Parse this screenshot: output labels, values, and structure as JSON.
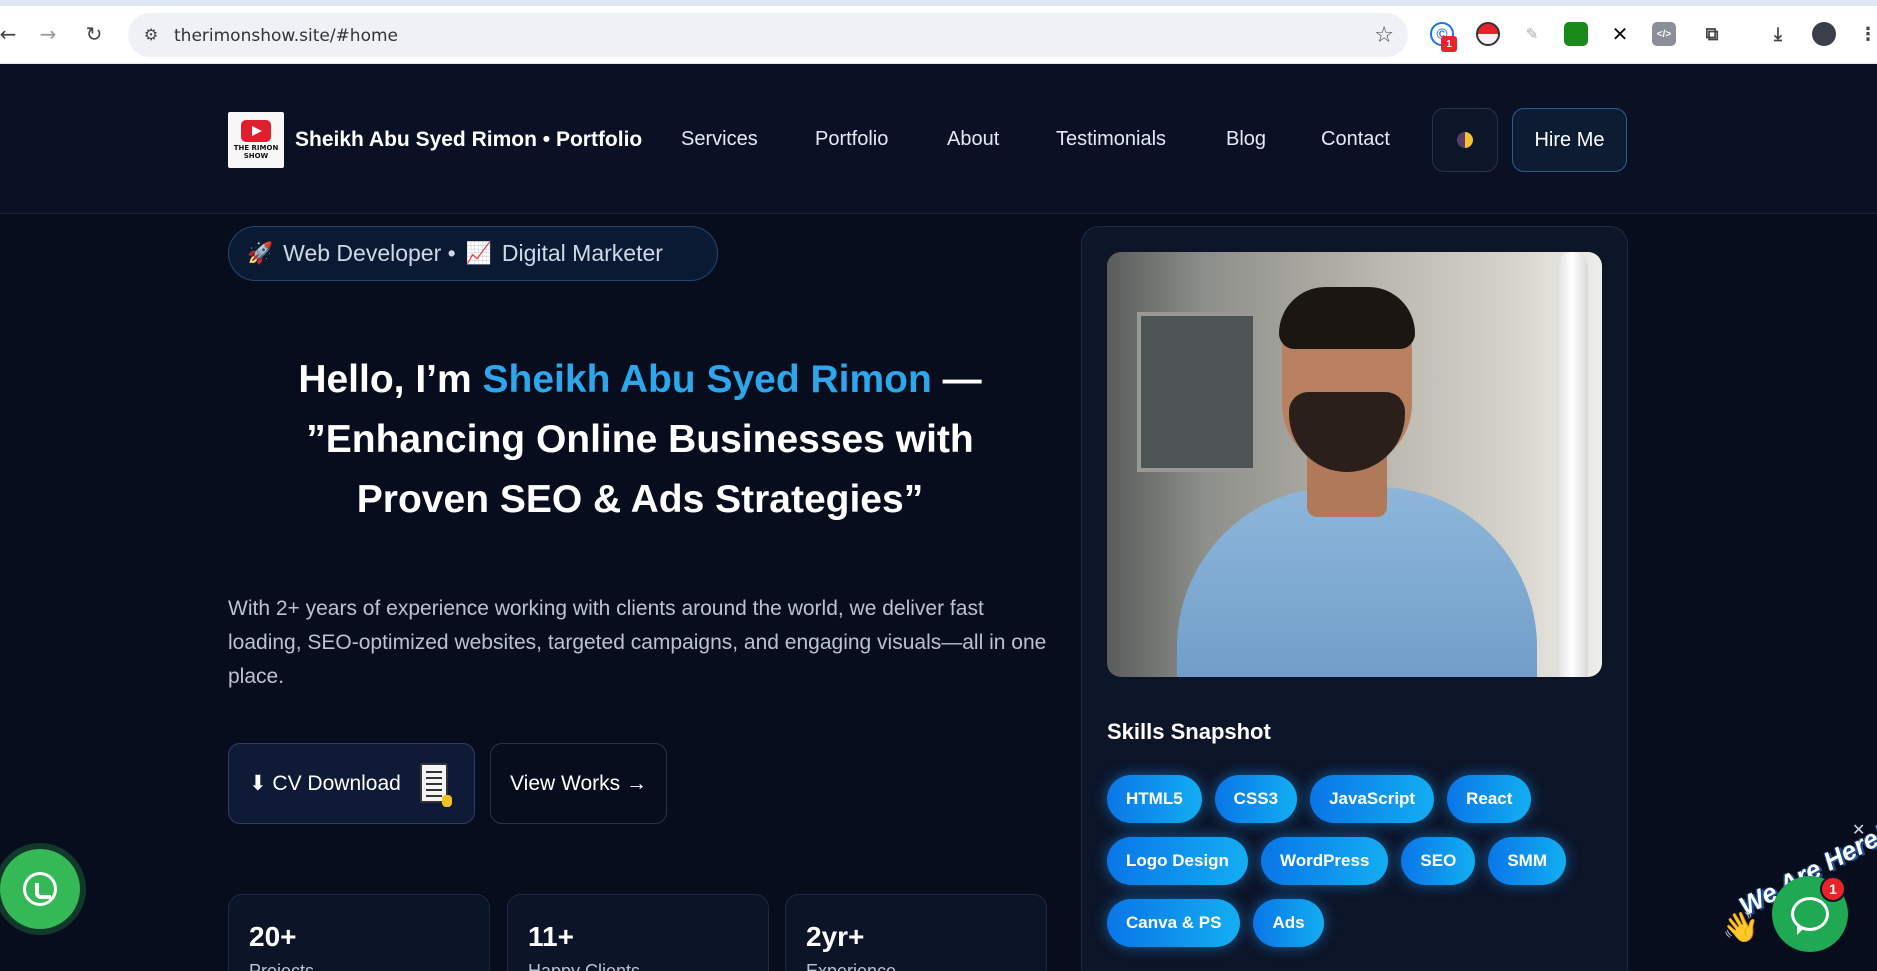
{
  "browser": {
    "url": "therimonshow.site/#home",
    "back_icon": "arrow-left-icon",
    "forward_icon": "arrow-right-icon",
    "reload_icon": "reload-icon",
    "extension_badge": "1"
  },
  "header": {
    "logo_text": "THE RIMON SHOW",
    "brand": "Sheikh Abu Syed Rimon • Portfolio",
    "nav": [
      "Services",
      "Portfolio",
      "About",
      "Testimonials",
      "Blog",
      "Contact"
    ],
    "hire_label": "Hire Me"
  },
  "hero": {
    "role_emoji_1": "🚀",
    "role_text_1": "Web Developer •",
    "role_emoji_2": "📈",
    "role_text_2": "Digital Marketer",
    "title_prefix": "Hello, I’m ",
    "title_name": "Sheikh Abu Syed Rimon",
    "title_suffix": " — ”Enhancing Online Businesses with Proven SEO & Ads Strategies”",
    "description": "With 2+ years of experience working with clients around the world, we deliver fast loading, SEO-optimized websites, targeted campaigns, and engaging visuals—all in one place.",
    "cv_label": "⬇ CV Download",
    "works_label": "View Works →"
  },
  "stats": [
    {
      "num": "20+",
      "label": "Projects"
    },
    {
      "num": "11+",
      "label": "Happy Clients"
    },
    {
      "num": "2yr+",
      "label": "Experience"
    }
  ],
  "profile": {
    "skills_title": "Skills Snapshot",
    "skills": [
      "HTML5",
      "CSS3",
      "JavaScript",
      "React",
      "Logo Design",
      "WordPress",
      "SEO",
      "SMM",
      "Canva & PS",
      "Ads"
    ]
  },
  "widgets": {
    "chat_tagline": "We Are Here!",
    "chat_badge": "1",
    "close_glyph": "✕",
    "wave_glyph": "👋"
  },
  "colors": {
    "background": "#070d1c",
    "accent": "#2ea6ec",
    "chip_gradient_start": "#0a76e8",
    "chip_gradient_end": "#13aef2",
    "whatsapp": "#35b856"
  }
}
